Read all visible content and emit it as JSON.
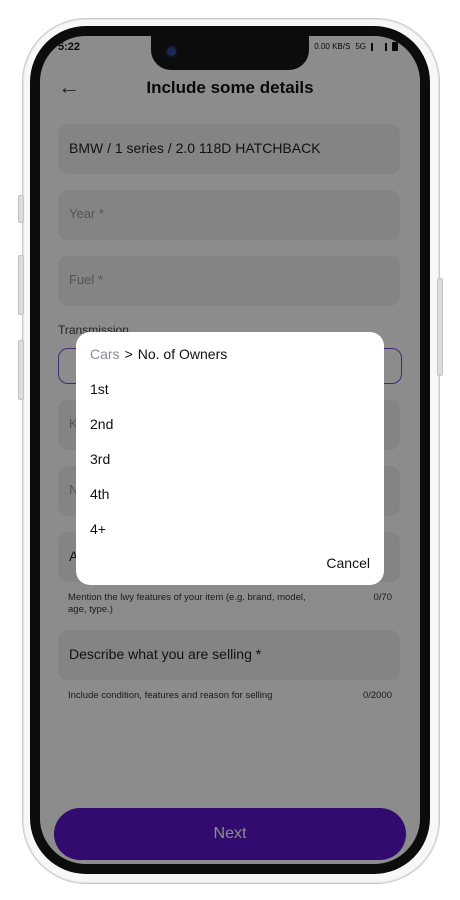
{
  "status": {
    "time": "5:22",
    "net": "0.00 KB/S",
    "network_type": "5G"
  },
  "header": {
    "title": "Include some details"
  },
  "form": {
    "vehicle": "BMW / 1 series / 2.0 118D HATCHBACK",
    "year_placeholder": "Year *",
    "fuel_placeholder": "Fuel *",
    "transmission_label": "Transmission",
    "km_placeholder": "K",
    "owners_placeholder": "N",
    "ad_title_placeholder": "A",
    "ad_title_helper": "Mention the lwy features of your item (e.g. brand, model, age, type.)",
    "ad_title_counter": "0/70",
    "describe_placeholder": "Describe what you are selling *",
    "describe_helper": "Include condition, features and reason for selling",
    "describe_counter": "0/2000"
  },
  "dialog": {
    "breadcrumb_root": "Cars",
    "breadcrumb_sep": ">",
    "breadcrumb_current": "No. of Owners",
    "options": [
      "1st",
      "2nd",
      "3rd",
      "4th",
      "4+"
    ],
    "cancel_label": "Cancel"
  },
  "footer": {
    "next_label": "Next"
  },
  "colors": {
    "accent": "#5a14c8",
    "selected_border": "#7b4fd0"
  }
}
